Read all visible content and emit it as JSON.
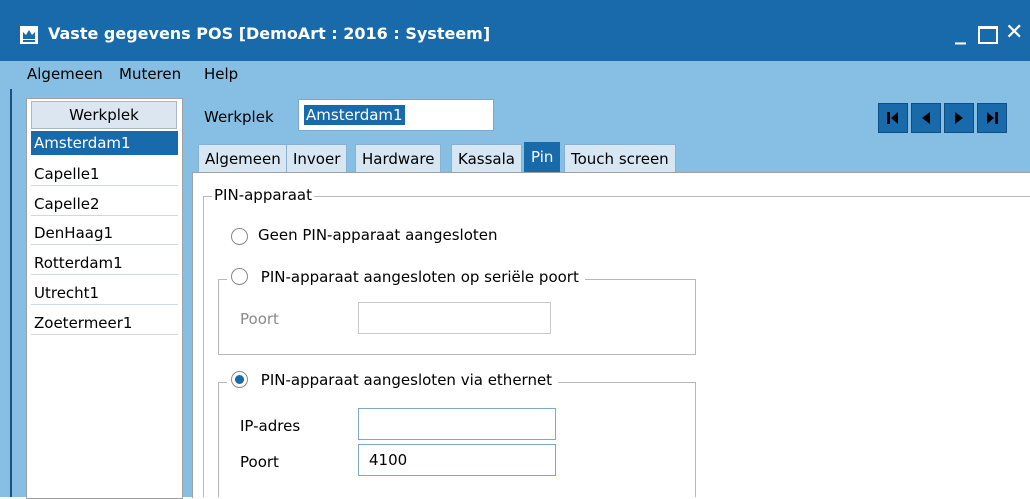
{
  "window": {
    "title": "Vaste gegevens POS  [DemoArt : 2016 : Systeem]",
    "minimize": "_",
    "close": "✕"
  },
  "menu": [
    "Algemeen",
    "Muteren",
    "Help"
  ],
  "list": {
    "header": "Werkplek",
    "items": [
      "Amsterdam1",
      "Capelle1",
      "Capelle2",
      "DenHaag1",
      "Rotterdam1",
      "Utrecht1",
      "Zoetermeer1"
    ],
    "selected": "Amsterdam1"
  },
  "werkplek": {
    "label": "Werkplek",
    "value": "Amsterdam1"
  },
  "navigation": {
    "icons": [
      "first-record-icon",
      "previous-record-icon",
      "next-record-icon",
      "last-record-icon"
    ]
  },
  "tabs": [
    "Algemeen",
    "Invoer",
    "Hardware",
    "Kassala",
    "Pin",
    "Touch screen"
  ],
  "active_tab": "Pin",
  "pin": {
    "group_title": "PIN-apparaat",
    "option_none": "Geen PIN-apparaat aangesloten",
    "option_serial": "PIN-apparaat aangesloten op seriële poort",
    "serial_port_label": "Poort",
    "serial_port_value": "",
    "option_ethernet": "PIN-apparaat aangesloten via ethernet",
    "ip_label": "IP-adres",
    "ip_value": "",
    "eth_port_label": "Poort",
    "eth_port_value": "4100",
    "selected_option": "ethernet"
  },
  "colors": {
    "titlebar": "#196aab",
    "menubar": "#86bfe3",
    "accent": "#196aab"
  }
}
